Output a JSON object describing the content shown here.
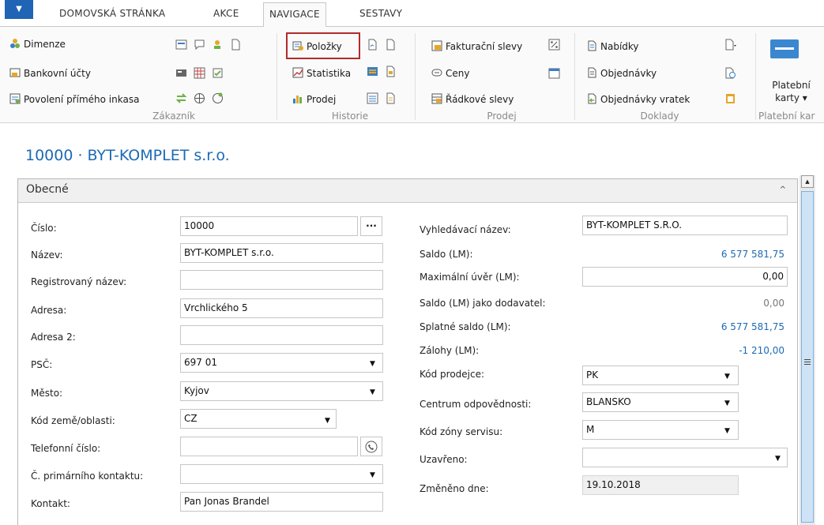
{
  "tabs": {
    "app": "▼",
    "home": "DOMOVSKÁ STRÁNKA",
    "actions": "AKCE",
    "navigation": "NAVIGACE",
    "reports": "SESTAVY"
  },
  "ribbon": {
    "customer": {
      "group": "Zákazník",
      "dimensions": "Dimenze",
      "bank_accounts": "Bankovní účty",
      "direct_debit": "Povolení přímého inkasa"
    },
    "history": {
      "group": "Historie",
      "entries": "Položky",
      "statistics": "Statistika",
      "sales": "Prodej"
    },
    "sales": {
      "group": "Prodej",
      "invoice_discounts": "Fakturační slevy",
      "prices": "Ceny",
      "line_discounts": "Řádkové slevy"
    },
    "documents": {
      "group": "Doklady",
      "quotes": "Nabídky",
      "orders": "Objednávky",
      "return_orders": "Objednávky vratek"
    },
    "payment": {
      "group": "Platební kar",
      "cards_line1": "Platební",
      "cards_line2": "karty ▾"
    }
  },
  "page_title": "10000 · BYT-KOMPLET s.r.o.",
  "panel": {
    "title": "Obecné",
    "collapse": "^"
  },
  "left": {
    "cislo": {
      "label": "Číslo:",
      "value": "10000",
      "button": "..."
    },
    "nazev": {
      "label": "Název:",
      "value": "BYT-KOMPLET s.r.o."
    },
    "reg": {
      "label": "Registrovaný název:",
      "value": ""
    },
    "adresa": {
      "label": "Adresa:",
      "value": "Vrchlického 5"
    },
    "adresa2": {
      "label": "Adresa 2:",
      "value": ""
    },
    "psc": {
      "label": "PSČ:",
      "value": "697 01"
    },
    "mesto": {
      "label": "Město:",
      "value": "Kyjov"
    },
    "zeme": {
      "label": "Kód země/oblasti:",
      "value": "CZ"
    },
    "telefon": {
      "label": "Telefonní číslo:",
      "value": ""
    },
    "kontakt_no": {
      "label": "Č. primárního kontaktu:",
      "value": ""
    },
    "kontakt": {
      "label": "Kontakt:",
      "value": "Pan Jonas Brandel"
    }
  },
  "right": {
    "vyhled": {
      "label": "Vyhledávací název:",
      "value": "BYT-KOMPLET S.R.O."
    },
    "saldo": {
      "label": "Saldo (LM):",
      "value": "6 577 581,75"
    },
    "maxuver": {
      "label": "Maximální úvěr (LM):",
      "value": "0,00"
    },
    "saldodod": {
      "label": "Saldo (LM) jako dodavatel:",
      "value": "0,00"
    },
    "splatne": {
      "label": "Splatné saldo (LM):",
      "value": "6 577 581,75"
    },
    "zalohy": {
      "label": "Zálohy (LM):",
      "value": "-1 210,00"
    },
    "prodejce": {
      "label": "Kód prodejce:",
      "value": "PK"
    },
    "centrum": {
      "label": "Centrum odpovědnosti:",
      "value": "BLANSKO"
    },
    "servis": {
      "label": "Kód zóny servisu:",
      "value": "M"
    },
    "uzavreno": {
      "label": "Uzavřeno:",
      "value": ""
    },
    "zmeneno": {
      "label": "Změněno dne:",
      "value": "19.10.2018"
    }
  },
  "colors": {
    "accent": "#1d6ab3",
    "highlight": "#b22b2b"
  }
}
